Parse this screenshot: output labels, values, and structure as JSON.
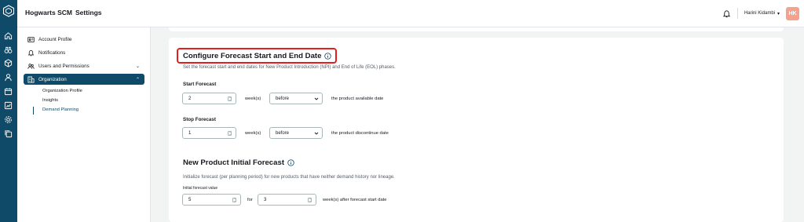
{
  "app": {
    "name": "Hogwarts SCM",
    "section": "Settings"
  },
  "user": {
    "name": "Harini Kidambi",
    "initials": "HK"
  },
  "colors": {
    "primary": "#0f4a68",
    "highlight": "#e41e1e",
    "avatar": "#f4a18e"
  },
  "rail_icons": [
    "home-icon",
    "binoculars-icon",
    "cube-icon",
    "gear-person-icon",
    "calendar-icon",
    "chart-icon",
    "settings-icon",
    "copy-icon"
  ],
  "sidebar": {
    "items": [
      {
        "label": "Account Profile",
        "icon": "account-card-icon"
      },
      {
        "label": "Notifications",
        "icon": "bell-icon"
      },
      {
        "label": "Users and Permissions",
        "icon": "users-icon"
      },
      {
        "label": "Organization",
        "icon": "organization-icon"
      }
    ],
    "subitems": [
      {
        "label": "Organization Profile"
      },
      {
        "label": "Insights"
      },
      {
        "label": "Demand Planning"
      }
    ]
  },
  "forecast": {
    "title": "Configure Forecast Start and End Date",
    "description": "Set the forecast start and end dates for New Product Introduction (NPI) and End of Life (EOL) phases.",
    "start": {
      "label": "Start Forecast",
      "value": "2",
      "unit": "week(s)",
      "relation": "before",
      "suffix": "the product available date"
    },
    "stop": {
      "label": "Stop Forecast",
      "value": "1",
      "unit": "week(s)",
      "relation": "before",
      "suffix": "the product discontinue date"
    }
  },
  "initial": {
    "title": "New Product Initial Forecast",
    "description": "Initialize forecast (per planning period) for new products that have neither demand history nor lineage.",
    "field_label": "Initial forecast value",
    "value": "5",
    "for_label": "for",
    "weeks": "3",
    "suffix": "week(s) after forecast start date"
  }
}
